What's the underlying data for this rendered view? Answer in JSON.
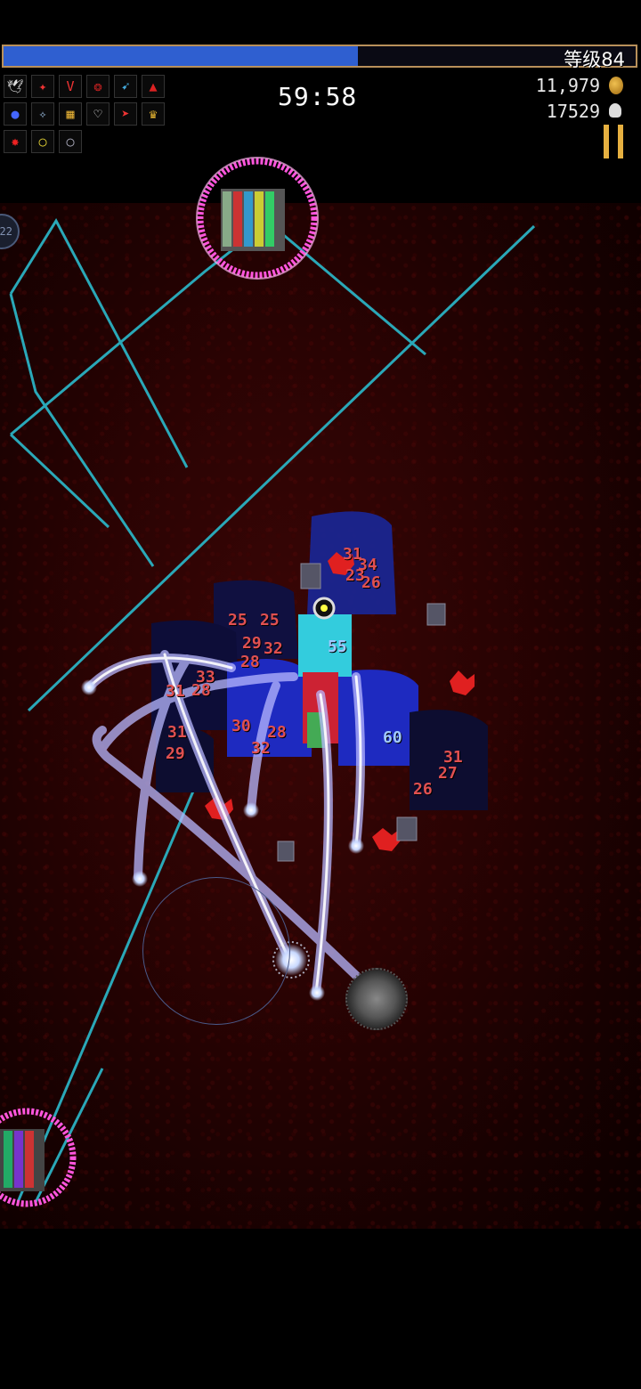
{
  "hud": {
    "level_label": "等级84",
    "xp_progress": 0.56,
    "timer": "59:58",
    "gold": "11,979",
    "kills": "17529",
    "side_badge": "22"
  },
  "weapons_row1": [
    "bird-icon",
    "compass-icon",
    "book-icon",
    "garlic-icon",
    "wand-icon",
    "cloak-icon"
  ],
  "weapons_row2": [
    "orb-icon",
    "crystal-icon",
    "lattice-icon",
    "heart-icon",
    "arrow-icon",
    "crown-icon"
  ],
  "weapons_row3": [
    "blood-icon",
    "gold-ring-icon",
    "silver-ring-icon"
  ],
  "weapon_glyphs": {
    "bird-icon": "🕊",
    "compass-icon": "✦",
    "book-icon": "V",
    "garlic-icon": "❂",
    "wand-icon": "➹",
    "cloak-icon": "▲",
    "orb-icon": "●",
    "crystal-icon": "✧",
    "lattice-icon": "▦",
    "heart-icon": "♡",
    "arrow-icon": "➤",
    "crown-icon": "♛",
    "blood-icon": "✸",
    "gold-ring-icon": "○",
    "silver-ring-icon": "○"
  },
  "colors": {
    "xp_fill": "#2f5fd0",
    "xp_border": "#b8905a",
    "laser": "#2aa8b8",
    "ring": "#ff55dd",
    "damage": "#e05050",
    "pause": "#e6b040"
  },
  "damage_numbers": [
    {
      "text": "31",
      "c": "r"
    },
    {
      "text": "34",
      "c": "r"
    },
    {
      "text": "23",
      "c": "r"
    },
    {
      "text": "26",
      "c": "r"
    },
    {
      "text": "25",
      "c": "r"
    },
    {
      "text": "25",
      "c": "r"
    },
    {
      "text": "29",
      "c": "r"
    },
    {
      "text": "32",
      "c": "r"
    },
    {
      "text": "28",
      "c": "r"
    },
    {
      "text": "33",
      "c": "r"
    },
    {
      "text": "55",
      "c": "b"
    },
    {
      "text": "31",
      "c": "r"
    },
    {
      "text": "28",
      "c": "r"
    },
    {
      "text": "31",
      "c": "r"
    },
    {
      "text": "29",
      "c": "r"
    },
    {
      "text": "28",
      "c": "r"
    },
    {
      "text": "60",
      "c": "b"
    },
    {
      "text": "31",
      "c": "r"
    },
    {
      "text": "27",
      "c": "r"
    },
    {
      "text": "26",
      "c": "r"
    },
    {
      "text": "32",
      "c": "r"
    },
    {
      "text": "30",
      "c": "r"
    }
  ]
}
